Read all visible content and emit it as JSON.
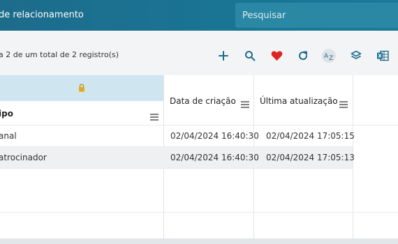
{
  "header": {
    "title": "de relacionamento",
    "search_placeholder": "Pesquisar"
  },
  "toolbar": {
    "record_count_text": "a 2 de um total de 2 registro(s)",
    "icons": [
      "plus-icon",
      "search-icon",
      "heart-icon",
      "refresh-icon",
      "sort-az-icon",
      "layers-icon",
      "excel-icon"
    ],
    "heart_color": "#e02424",
    "icon_color": "#1d6c8c"
  },
  "table": {
    "columns": {
      "tipo": "ipo",
      "created": "Data de criação",
      "updated": "Última atualização"
    },
    "rows": [
      {
        "tipo": "anal",
        "created": "02/04/2024 16:40:30",
        "updated": "02/04/2024 17:05:15"
      },
      {
        "tipo": "atrocinador",
        "created": "02/04/2024 16:40:30",
        "updated": "02/04/2024 17:05:13"
      }
    ]
  }
}
